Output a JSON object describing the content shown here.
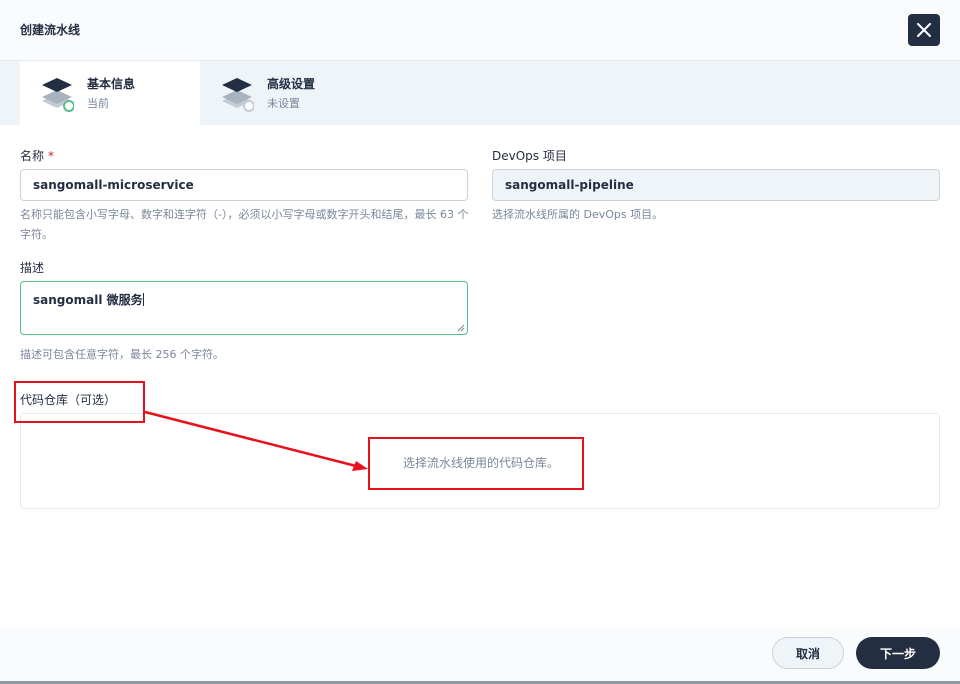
{
  "modal": {
    "title": "创建流水线"
  },
  "steps": [
    {
      "title": "基本信息",
      "status": "当前"
    },
    {
      "title": "高级设置",
      "status": "未设置"
    }
  ],
  "form": {
    "name": {
      "label": "名称",
      "required_mark": "*",
      "value": "sangomall-microservice",
      "hint": "名称只能包含小写字母、数字和连字符（-），必须以小写字母或数字开头和结尾，最长 63 个字符。"
    },
    "devops": {
      "label": "DevOps 项目",
      "value": "sangomall-pipeline",
      "hint": "选择流水线所属的 DevOps 项目。"
    },
    "description": {
      "label": "描述",
      "value": "sangomall 微服务",
      "hint": "描述可包含任意字符，最长 256 个字符。"
    },
    "repo": {
      "label": "代码仓库（可选）",
      "placeholder": "选择流水线使用的代码仓库。"
    }
  },
  "footer": {
    "cancel_label": "取消",
    "next_label": "下一步"
  },
  "colors": {
    "primary_dark": "#242e42",
    "success_green": "#55bc8a",
    "annotation_red": "#e8101a",
    "required_red": "#ca2621"
  }
}
